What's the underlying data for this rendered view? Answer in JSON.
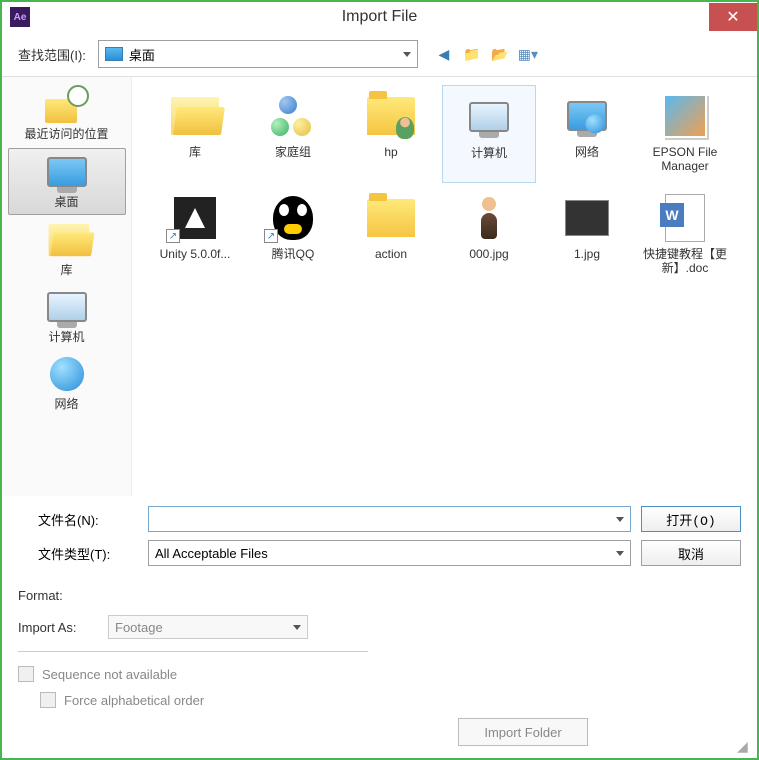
{
  "window": {
    "title": "Import File",
    "app_icon_text": "Ae"
  },
  "toolbar": {
    "lookin_label": "查找范围(I):",
    "location": "桌面",
    "icons": [
      "back",
      "up",
      "new-folder",
      "view-menu"
    ]
  },
  "sidebar": {
    "items": [
      {
        "label": "最近访问的位置",
        "icon": "recent"
      },
      {
        "label": "桌面",
        "icon": "desktop",
        "selected": true
      },
      {
        "label": "库",
        "icon": "libraries"
      },
      {
        "label": "计算机",
        "icon": "computer"
      },
      {
        "label": "网络",
        "icon": "network"
      }
    ]
  },
  "files": [
    {
      "label": "库",
      "icon": "folder-open"
    },
    {
      "label": "家庭组",
      "icon": "spheres"
    },
    {
      "label": "hp",
      "icon": "folder-user"
    },
    {
      "label": "计算机",
      "icon": "computer",
      "selected": true
    },
    {
      "label": "网络",
      "icon": "network-monitor"
    },
    {
      "label": "EPSON File Manager",
      "icon": "epson"
    },
    {
      "label": "Unity 5.0.0f...",
      "icon": "unity",
      "shortcut": true
    },
    {
      "label": "腾讯QQ",
      "icon": "qq",
      "shortcut": true
    },
    {
      "label": "action",
      "icon": "folder"
    },
    {
      "label": "000.jpg",
      "icon": "image-person"
    },
    {
      "label": "1.jpg",
      "icon": "image-thumb"
    },
    {
      "label": "快捷键教程【更新】.doc",
      "icon": "word"
    }
  ],
  "filebar": {
    "filename_label": "文件名(N):",
    "filename_value": "",
    "filetype_label": "文件类型(T):",
    "filetype_value": "All Acceptable Files",
    "open_label": "打开(O)",
    "cancel_label": "取消"
  },
  "options": {
    "format_label": "Format:",
    "format_value": "",
    "importas_label": "Import As:",
    "importas_value": "Footage",
    "seq_label": "Sequence not available",
    "alpha_label": "Force alphabetical order",
    "import_folder_label": "Import Folder"
  }
}
